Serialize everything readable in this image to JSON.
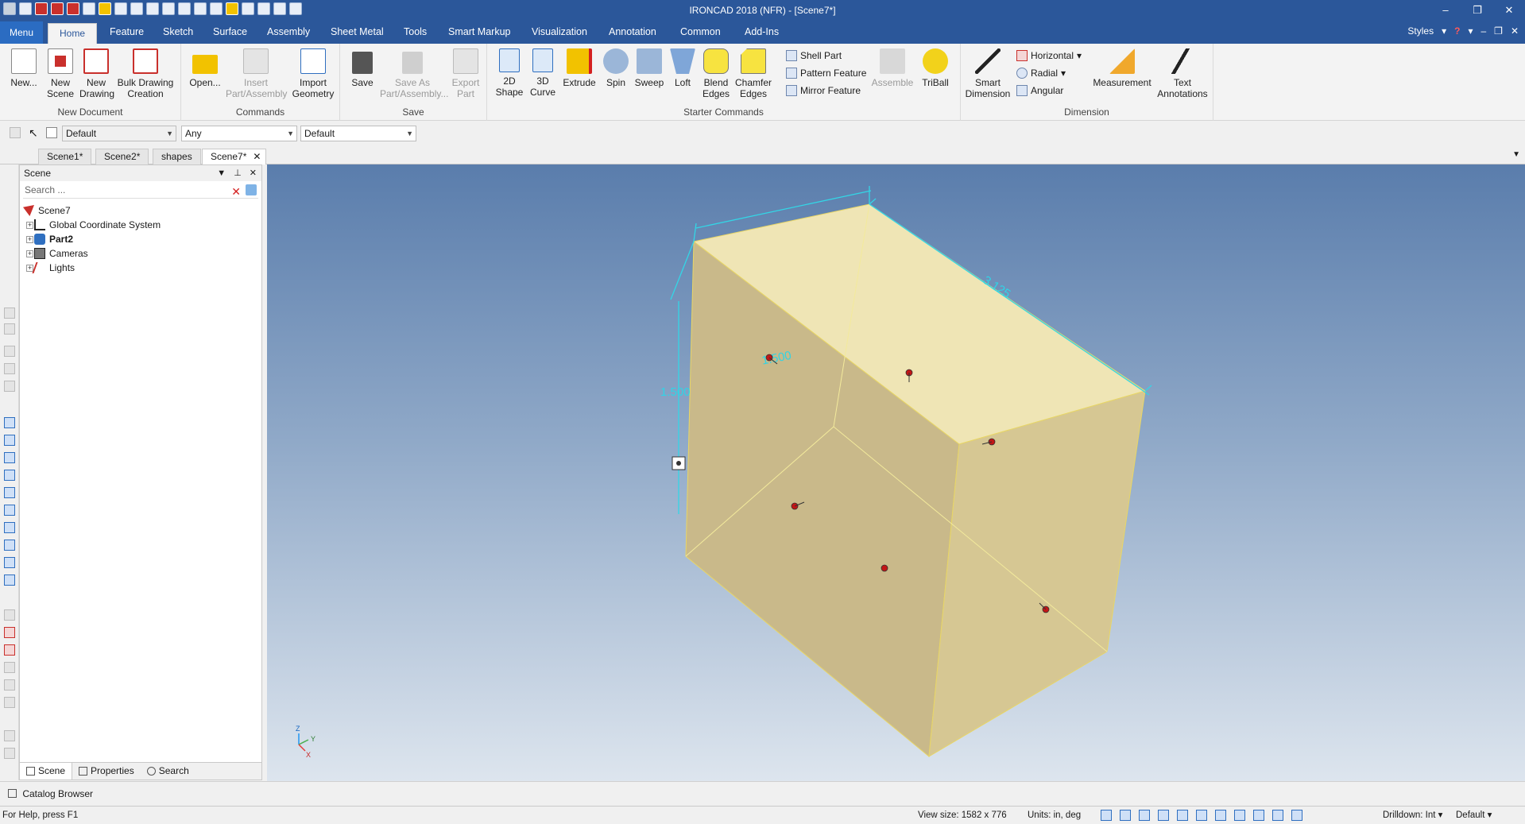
{
  "window": {
    "title": "IRONCAD 2018 (NFR) - [Scene7*]",
    "controls": [
      "–",
      "❐",
      "✕"
    ]
  },
  "ribbon_tabs": {
    "menu": "Menu",
    "items": [
      "Home",
      "Feature",
      "Sketch",
      "Surface",
      "Assembly",
      "Sheet Metal",
      "Tools",
      "Smart Markup",
      "Visualization",
      "Annotation",
      "Common",
      "Add-Ins"
    ],
    "styles": "Styles"
  },
  "ribbon": {
    "new_document": {
      "label": "New Document",
      "new": "New...",
      "new_scene": "New\nScene",
      "new_drawing": "New\nDrawing",
      "bulk": "Bulk Drawing\nCreation"
    },
    "commands": {
      "label": "Commands",
      "open": "Open...",
      "insert": "Insert\nPart/Assembly",
      "import": "Import\nGeometry"
    },
    "save": {
      "label": "Save",
      "save": "Save",
      "save_as": "Save As\nPart/Assembly...",
      "export": "Export\nPart"
    },
    "starter": {
      "label": "Starter Commands",
      "shape2d": "2D\nShape",
      "curve3d": "3D\nCurve",
      "extrude": "Extrude",
      "spin": "Spin",
      "sweep": "Sweep",
      "loft": "Loft",
      "blend": "Blend\nEdges",
      "chamfer": "Chamfer\nEdges",
      "shell": "Shell Part",
      "pattern": "Pattern Feature",
      "mirror": "Mirror Feature",
      "assemble": "Assemble",
      "triball": "TriBall"
    },
    "dimension": {
      "label": "Dimension",
      "smart": "Smart\nDimension",
      "horizontal": "Horizontal",
      "radial": "Radial",
      "angular": "Angular",
      "measurement": "Measurement",
      "text_annotations": "Text\nAnnotations"
    }
  },
  "selection_bar": {
    "combo1": "Default",
    "combo2": "Any",
    "combo3": "Default"
  },
  "doc_tabs": [
    "Scene1*",
    "Scene2*",
    "shapes",
    "Scene7*"
  ],
  "scene_panel": {
    "title": "Scene",
    "search_placeholder": "Search ...",
    "tree": {
      "root": "Scene7",
      "children": [
        "Global Coordinate System",
        "Part2",
        "Cameras",
        "Lights"
      ]
    },
    "bottom_tabs": [
      "Scene",
      "Properties",
      "Search"
    ]
  },
  "viewport": {
    "dim_width": "1.500",
    "dim_height": "1.500",
    "dim_length": "3.125",
    "axis_z": "Z",
    "axis_y": "Y",
    "axis_x": "X"
  },
  "catalog": "Catalog Browser",
  "status": {
    "help": "For Help, press F1",
    "view_size": "View size: 1582 x  776",
    "units": "Units: in, deg",
    "drilldown": "Drilldown: Int",
    "default": "Default"
  },
  "colors": {
    "ribbon_blue": "#2b579a",
    "part_face": "#efe5b5",
    "dimension": "#33d6e6"
  }
}
